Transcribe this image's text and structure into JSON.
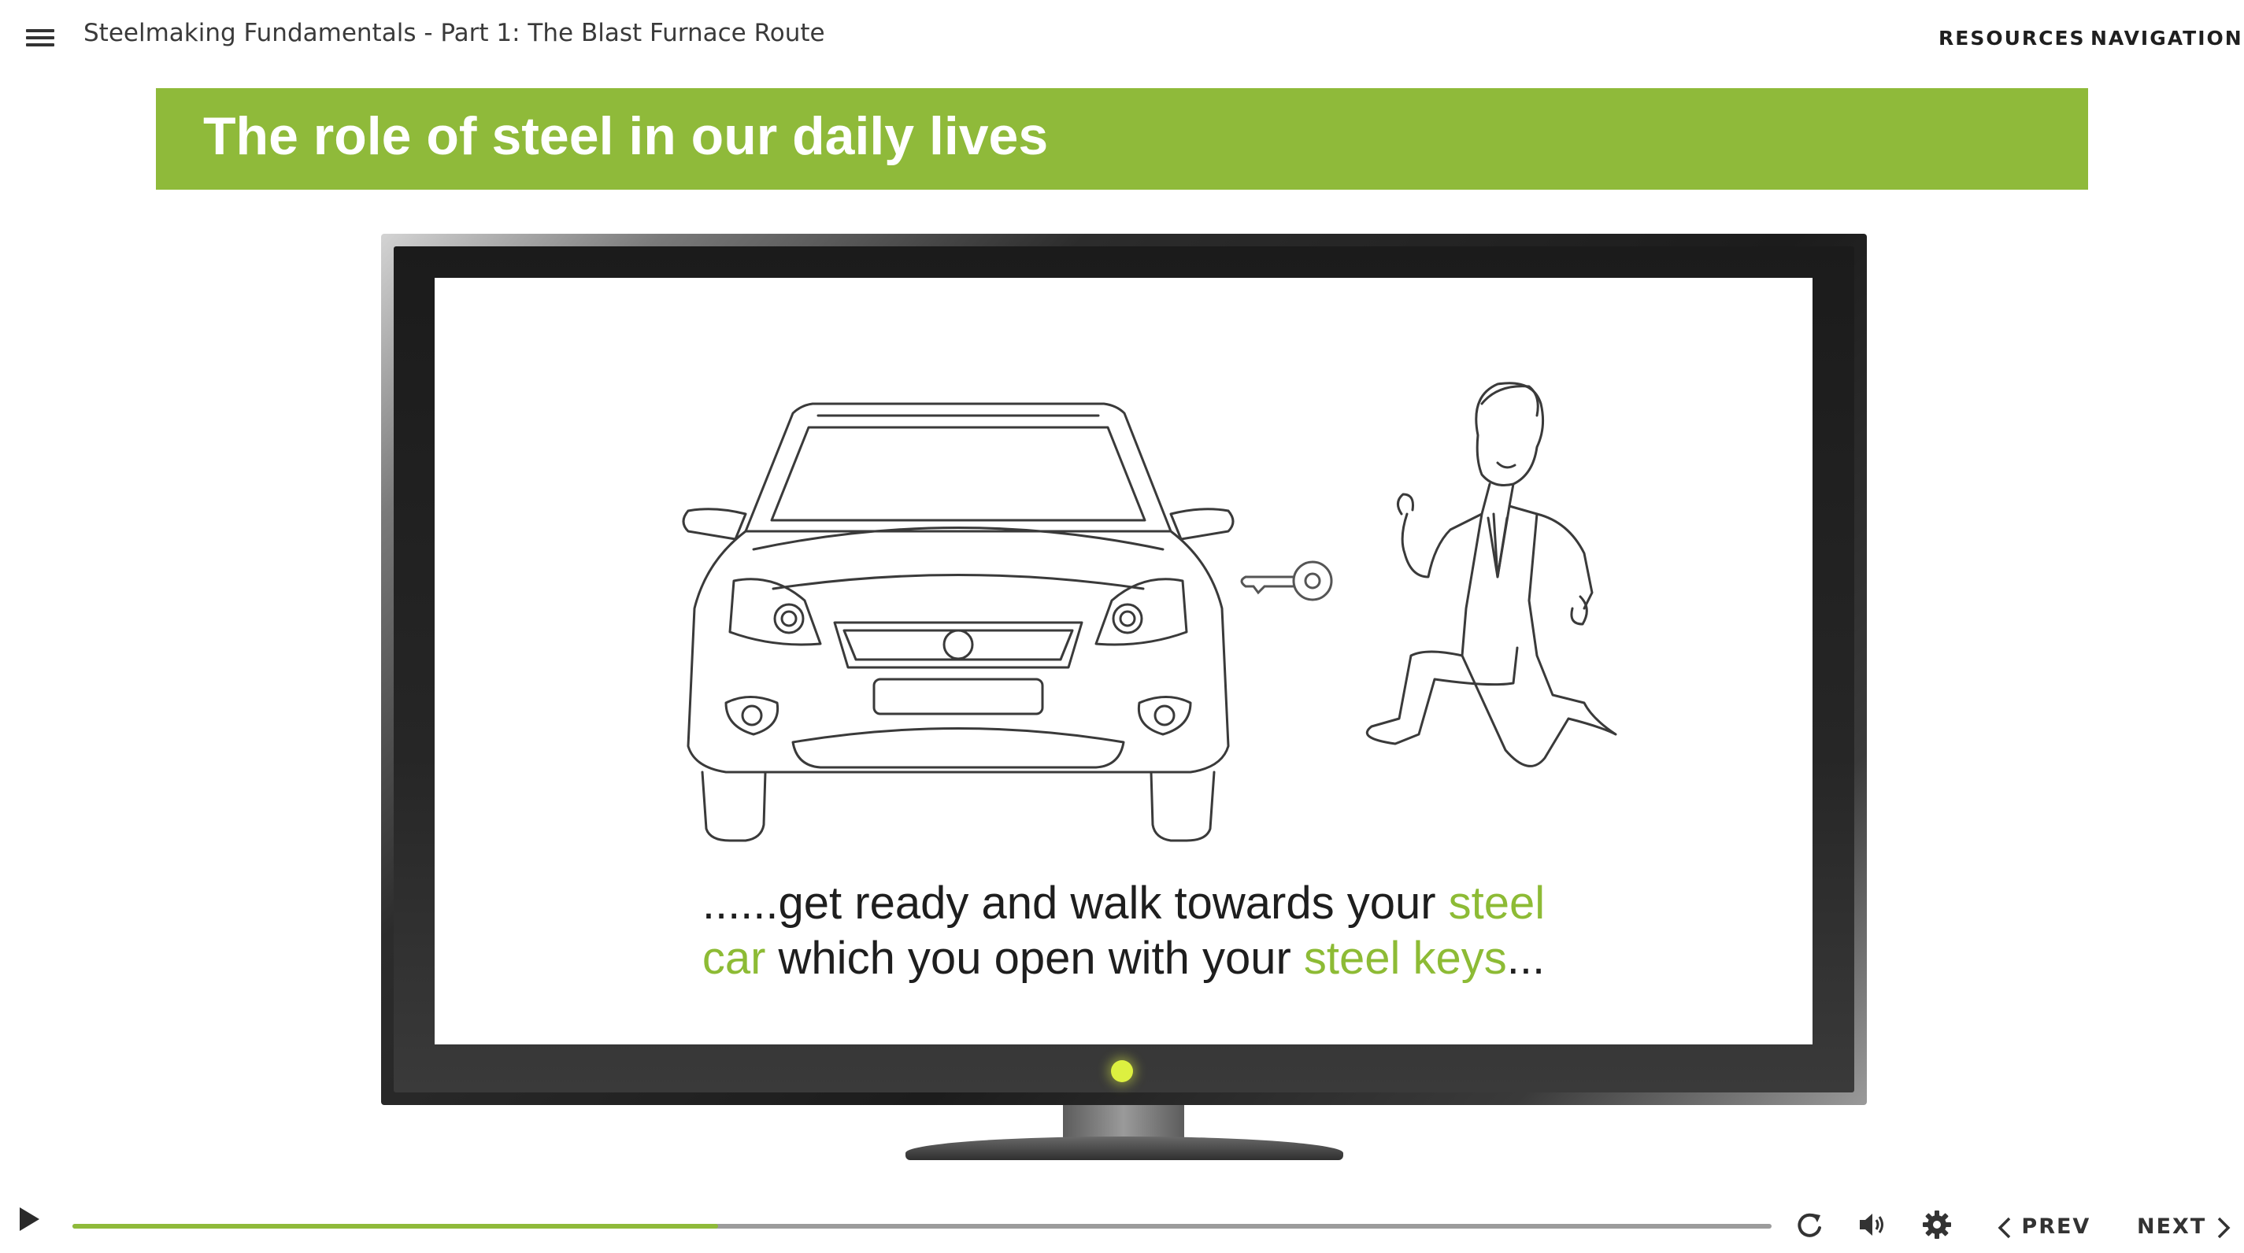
{
  "header": {
    "course_title": "Steelmaking Fundamentals - Part 1: The Blast Furnace Route",
    "resources_label": "RESOURCES",
    "navigation_label": "NAVIGATION",
    "menu_icon": "hamburger-menu-icon"
  },
  "slide": {
    "title": "The role of steel in our daily lives",
    "caption": {
      "line1_prefix": "......get ready and walk towards your ",
      "line1_highlight": "steel",
      "line2_highlight1": "car",
      "line2_middle": " which you open with your ",
      "line2_highlight2": "steel keys",
      "line2_suffix": "..."
    }
  },
  "player": {
    "progress_fraction": 0.38,
    "prev_label": "PREV",
    "next_label": "NEXT",
    "icons": [
      "play-icon",
      "replay-icon",
      "volume-icon",
      "settings-gear-icon",
      "chevron-left-icon",
      "chevron-right-icon"
    ]
  },
  "colors": {
    "accent_green": "#8fba3a",
    "highlight_text": "#8dbb35",
    "progress_green": "#8fba3a",
    "tv_led": "#ddf040"
  }
}
